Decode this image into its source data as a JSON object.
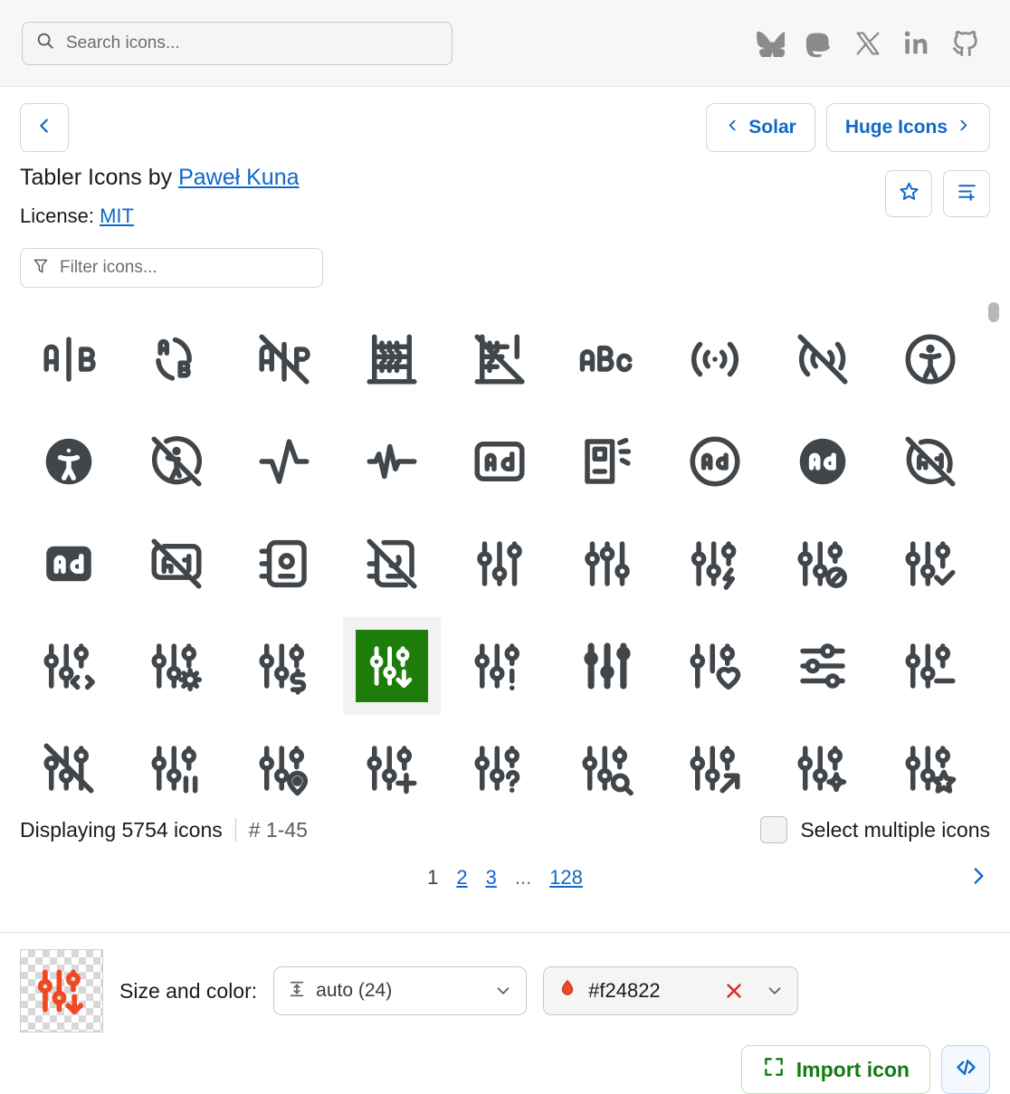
{
  "header": {
    "search": {
      "placeholder": "Search icons...",
      "value": "",
      "icon": "search-icon"
    },
    "socials": [
      {
        "name": "bluesky-icon",
        "label": "Bluesky"
      },
      {
        "name": "mastodon-icon",
        "label": "Mastodon"
      },
      {
        "name": "x-icon",
        "label": "X"
      },
      {
        "name": "linkedin-icon",
        "label": "LinkedIn"
      },
      {
        "name": "github-icon",
        "label": "GitHub"
      }
    ]
  },
  "nav": {
    "back_icon": "chevron-left-icon",
    "prev_pack_label": "Solar",
    "next_pack_label": "Huge Icons",
    "favorite_icon": "star-icon",
    "addlist_icon": "list-add-icon"
  },
  "pack": {
    "title_prefix": "Tabler Icons by ",
    "author": "Paweł Kuna",
    "license_label": "License: ",
    "license_value": "MIT"
  },
  "filter": {
    "placeholder": "Filter icons...",
    "value": "",
    "icon": "filter-icon"
  },
  "grid": {
    "selected_index": 30,
    "selected_bg": "#1d7d0a",
    "icons": [
      {
        "name": "a-b"
      },
      {
        "name": "a-b-2"
      },
      {
        "name": "a-b-off"
      },
      {
        "name": "abacus"
      },
      {
        "name": "abacus-off"
      },
      {
        "name": "abc"
      },
      {
        "name": "access-point"
      },
      {
        "name": "access-point-off"
      },
      {
        "name": "accessible"
      },
      {
        "name": "accessible-filled"
      },
      {
        "name": "accessible-off"
      },
      {
        "name": "activity"
      },
      {
        "name": "activity-heartbeat"
      },
      {
        "name": "ad"
      },
      {
        "name": "ad-2"
      },
      {
        "name": "ad-circle"
      },
      {
        "name": "ad-circle-filled"
      },
      {
        "name": "ad-circle-off"
      },
      {
        "name": "ad-filled"
      },
      {
        "name": "ad-off"
      },
      {
        "name": "address-book"
      },
      {
        "name": "address-book-off"
      },
      {
        "name": "adjustments"
      },
      {
        "name": "adjustments-alt"
      },
      {
        "name": "adjustments-bolt"
      },
      {
        "name": "adjustments-cancel"
      },
      {
        "name": "adjustments-check"
      },
      {
        "name": "adjustments-code"
      },
      {
        "name": "adjustments-cog"
      },
      {
        "name": "adjustments-dollar"
      },
      {
        "name": "adjustments-down"
      },
      {
        "name": "adjustments-exclamation"
      },
      {
        "name": "adjustments-filled"
      },
      {
        "name": "adjustments-heart"
      },
      {
        "name": "adjustments-horizontal"
      },
      {
        "name": "adjustments-minus"
      },
      {
        "name": "adjustments-off"
      },
      {
        "name": "adjustments-pause"
      },
      {
        "name": "adjustments-pin"
      },
      {
        "name": "adjustments-plus"
      },
      {
        "name": "adjustments-question"
      },
      {
        "name": "adjustments-search"
      },
      {
        "name": "adjustments-share"
      },
      {
        "name": "adjustments-spark"
      },
      {
        "name": "adjustments-star"
      }
    ]
  },
  "status": {
    "displaying": "Displaying 5754 icons",
    "range": "# 1-45",
    "select_multiple_label": "Select multiple icons",
    "select_multiple_checked": false
  },
  "pagination": {
    "pages": [
      {
        "label": "1",
        "current": true
      },
      {
        "label": "2",
        "current": false
      },
      {
        "label": "3",
        "current": false
      },
      {
        "label": "...",
        "current": false,
        "ellipsis": true
      },
      {
        "label": "128",
        "current": false
      }
    ],
    "next_icon": "chevron-right-icon"
  },
  "toolbar": {
    "preview_icon": "adjustments-down",
    "size_label": "Size and color:",
    "size_value": "auto (24)",
    "size_icon": "arrow-autofit-height-icon",
    "color_value": "#f24822",
    "color_icon": "droplet-icon",
    "color_clear_icon": "close-icon",
    "import_label": "Import icon",
    "import_icon": "frame-corners-icon",
    "code_icon": "code-icon"
  }
}
